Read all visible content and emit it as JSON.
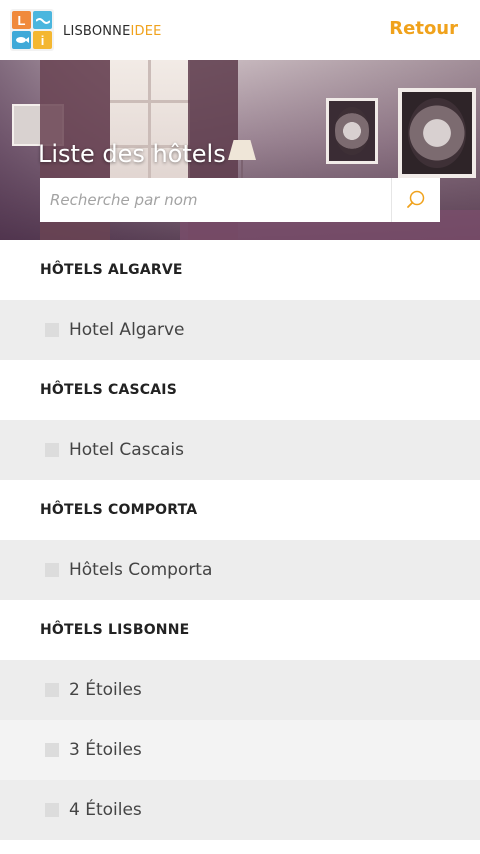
{
  "header": {
    "logo_letters": [
      "L",
      "",
      "",
      "i"
    ],
    "brand_primary": "LISBONNE",
    "brand_secondary": "IDEE",
    "back_label": "Retour"
  },
  "hero": {
    "title": "Liste des hôtels",
    "search_placeholder": "Recherche par nom"
  },
  "sections": [
    {
      "title": "HÔTELS ALGARVE",
      "items": [
        {
          "label": "Hotel Algarve"
        }
      ]
    },
    {
      "title": "HÔTELS CASCAIS",
      "items": [
        {
          "label": "Hotel Cascais"
        }
      ]
    },
    {
      "title": "HÔTELS COMPORTA",
      "items": [
        {
          "label": "Hôtels Comporta"
        }
      ]
    },
    {
      "title": "HÔTELS LISBONNE",
      "items": [
        {
          "label": "2 Étoiles"
        },
        {
          "label": "3 Étoiles"
        },
        {
          "label": "4 Étoiles"
        }
      ]
    }
  ],
  "colors": {
    "accent": "#f0a21c",
    "row_primary": "#ededed",
    "row_alt": "#f3f3f3"
  }
}
